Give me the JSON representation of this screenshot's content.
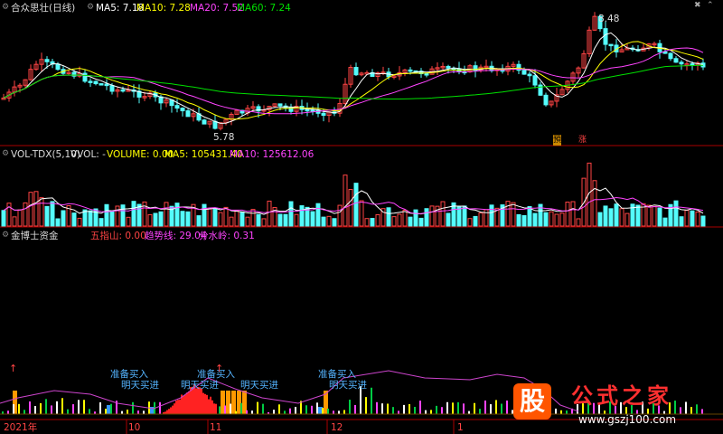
{
  "colors": {
    "up": "#ff4444",
    "down": "#54fcfc",
    "ma5": "#ffffff",
    "ma10": "#ffff00",
    "ma20": "#ff44ff",
    "ma60": "#00e000",
    "grid": "#aa0000"
  },
  "price_header": {
    "title": "合众思壮(日线)",
    "ma5": "MA5: 7.18",
    "ma10": "MA10: 7.28",
    "ma20": "MA20: 7.52",
    "ma60": "MA60: 7.24"
  },
  "price_labels": {
    "high": "8.48",
    "low": "5.78",
    "tag1": "預",
    "tag2": "涨"
  },
  "volume_header": {
    "name": "VOL-TDX(5,10)",
    "vvol": "VVOL: -",
    "volume": "VOLUME: 0.00",
    "ma5": "MA5: 105431.40",
    "ma10": "MA10: 125612.06"
  },
  "indicator_header": {
    "name": "金博士资金",
    "wuzhishan": "五指山: 0.00",
    "trend": "趋势线: 29.04",
    "water": "分水岭: 0.31"
  },
  "signals": {
    "prepare_buy": "准备买入",
    "tomorrow_buy": "明天买进"
  },
  "x_axis": {
    "labels": [
      "2021年",
      "10",
      "11",
      "12",
      "1"
    ]
  },
  "watermark": {
    "logo": "股",
    "text": "公式之家",
    "url": "www.gszj100.com"
  },
  "chart_data": [
    {
      "type": "candlestick",
      "title": "合众思壮(日线)",
      "series": [
        "MA5",
        "MA10",
        "MA20",
        "MA60"
      ],
      "annotations": {
        "high": 8.48,
        "low": 5.78
      },
      "ma_values": {
        "MA5": 7.18,
        "MA10": 7.28,
        "MA20": 7.52,
        "MA60": 7.24
      }
    },
    {
      "type": "bar",
      "title": "VOL-TDX(5,10)",
      "series": [
        "VOLUME",
        "MA5",
        "MA10"
      ],
      "values": {
        "VOLUME": 0.0,
        "MA5": 105431.4,
        "MA10": 125612.06
      }
    },
    {
      "type": "bar",
      "title": "金博士资金",
      "series": [
        "五指山",
        "趋势线",
        "分水岭"
      ],
      "values": {
        "五指山": 0.0,
        "趋势线": 29.04,
        "分水岭": 0.31
      }
    }
  ]
}
